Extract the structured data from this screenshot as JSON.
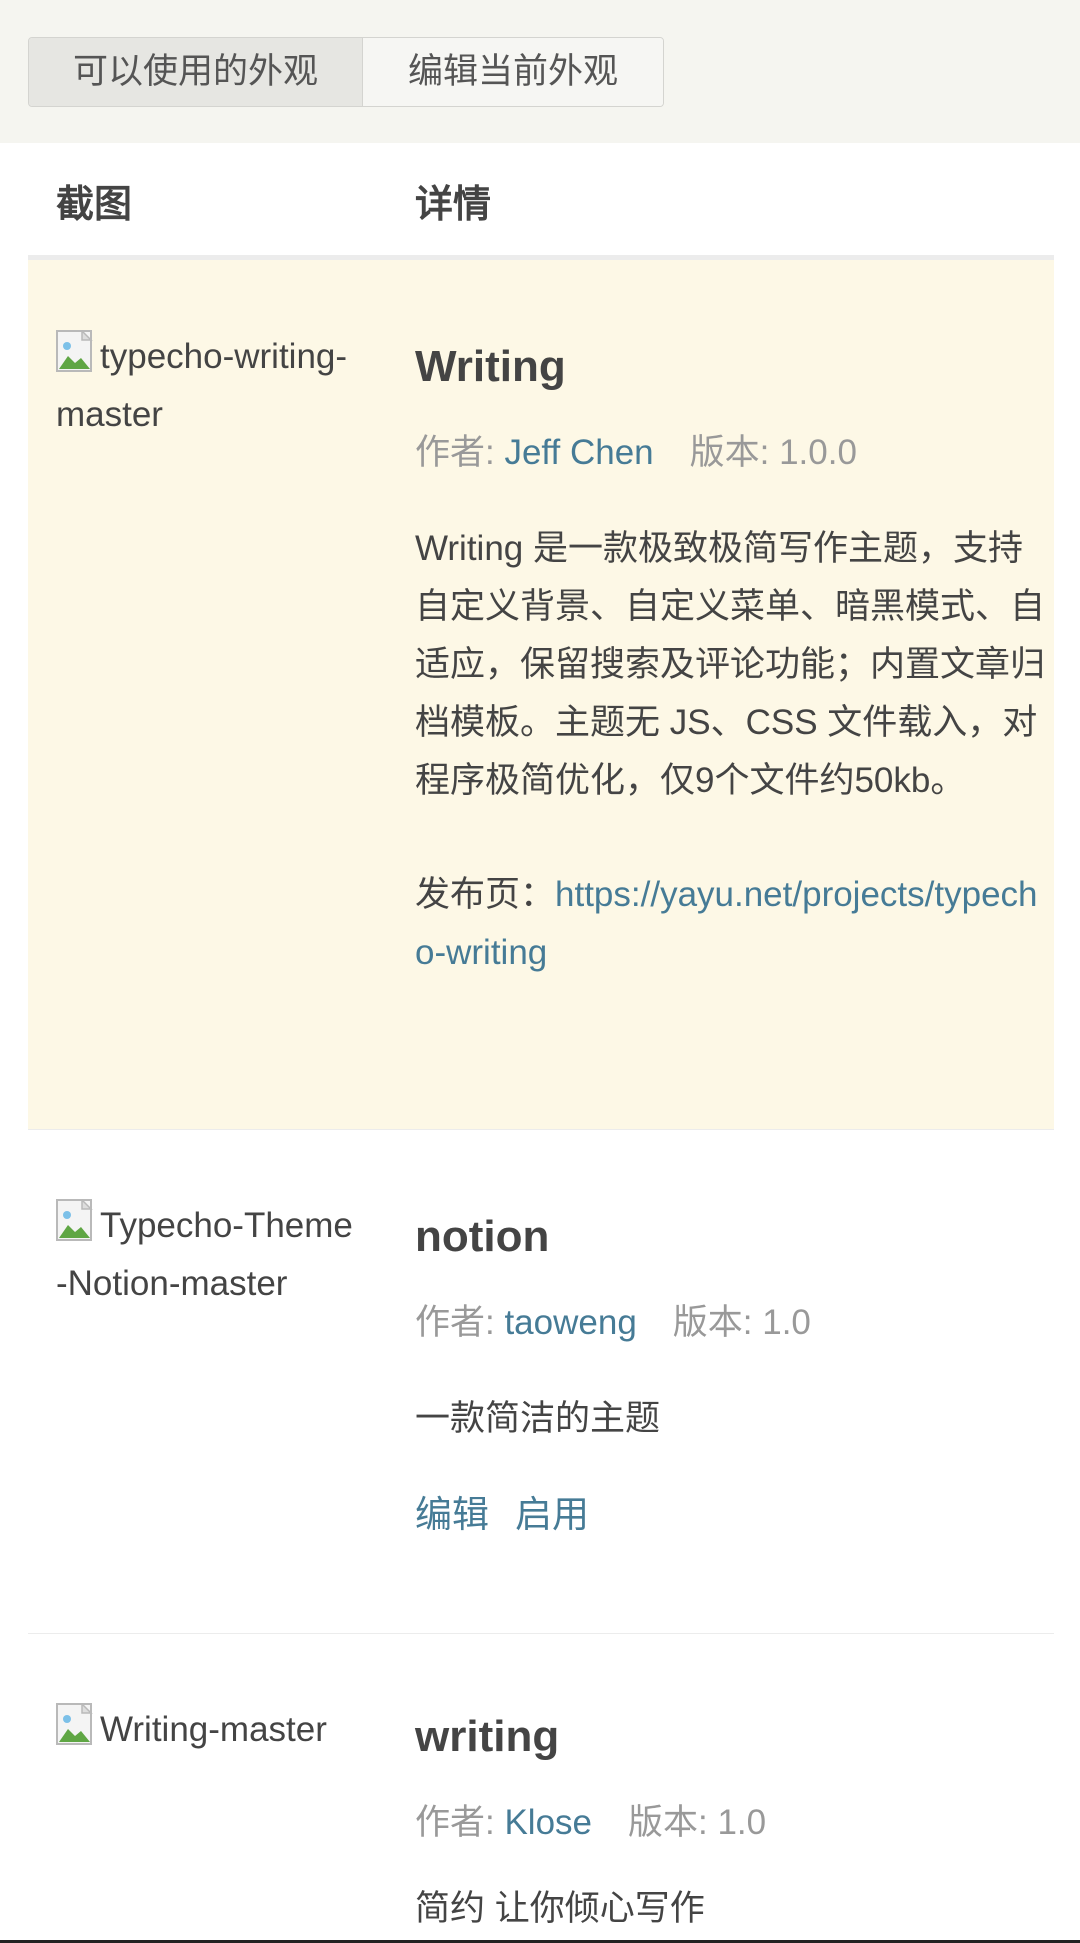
{
  "tabs": {
    "available": "可以使用的外观",
    "edit_current": "编辑当前外观"
  },
  "table_header": {
    "screenshot": "截图",
    "details": "详情"
  },
  "themes": [
    {
      "screenshot_alt": "typecho-writing-master",
      "name": "Writing",
      "author_label": "作者: ",
      "author": "Jeff Chen",
      "version_label": "版本: ",
      "version": "1.0.0",
      "description": "Writing 是一款极致极简写作主题，支持自定义背景、自定义菜单、暗黑模式、自适应，保留搜索及评论功能；内置文章归档模板。主题无 JS、CSS 文件载入，对程序极简优化，仅9个文件约50kb。",
      "release_label": "发布页：",
      "release_url": "https://yayu.net/projects/typecho-writing"
    },
    {
      "screenshot_alt": "Typecho-Theme-Notion-master",
      "name": "notion",
      "author_label": "作者: ",
      "author": "taoweng",
      "version_label": "版本: ",
      "version": "1.0",
      "description": "一款简洁的主题",
      "edit_label": "编辑",
      "enable_label": "启用"
    },
    {
      "screenshot_alt": "Writing-master",
      "name": "writing",
      "author_label": "作者: ",
      "author": "Klose",
      "version_label": "版本: ",
      "version": "1.0",
      "description": "简约 让你倾心写作"
    }
  ],
  "colors": {
    "link": "#467b96",
    "current_row_bg": "#fdf8e6",
    "topbar_bg": "#f5f5f0"
  }
}
